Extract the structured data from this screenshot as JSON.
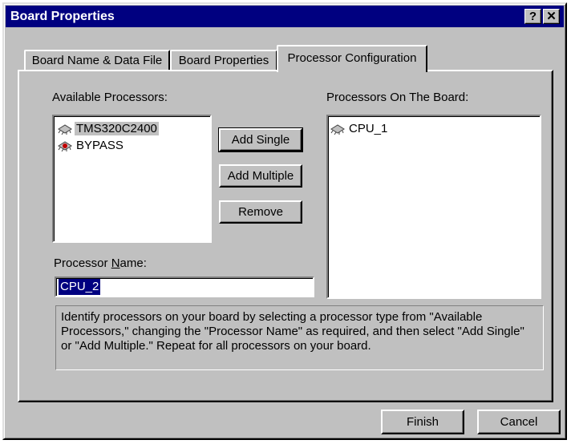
{
  "window": {
    "title": "Board Properties",
    "help_glyph": "?",
    "close_glyph": "✕"
  },
  "tabs": [
    {
      "label": "Board Name & Data File",
      "active": false
    },
    {
      "label": "Board Properties",
      "active": false
    },
    {
      "label": "Processor Configuration",
      "active": true
    }
  ],
  "available": {
    "label_pre": "Available Processors:",
    "items": [
      "TMS320C2400",
      "BYPASS"
    ],
    "selected": "TMS320C2400"
  },
  "board": {
    "label": "Processors On The Board:",
    "items": [
      "CPU_1"
    ]
  },
  "buttons": {
    "add_single": "Add Single",
    "add_multiple": "Add Multiple",
    "remove": "Remove",
    "finish": "Finish",
    "cancel": "Cancel"
  },
  "processor_name": {
    "label_pre": "Processor ",
    "label_key": "N",
    "label_post": "ame:",
    "value": "CPU_2"
  },
  "help_text": "Identify processors on your board by selecting a processor type from \"Available Processors,\" changing the \"Processor Name\" as required, and then select \"Add Single\" or \"Add Multiple.\"  Repeat for all processors on your board.",
  "icons": {
    "processor": "chip-icon",
    "bypass": "bypass-chip-icon"
  }
}
